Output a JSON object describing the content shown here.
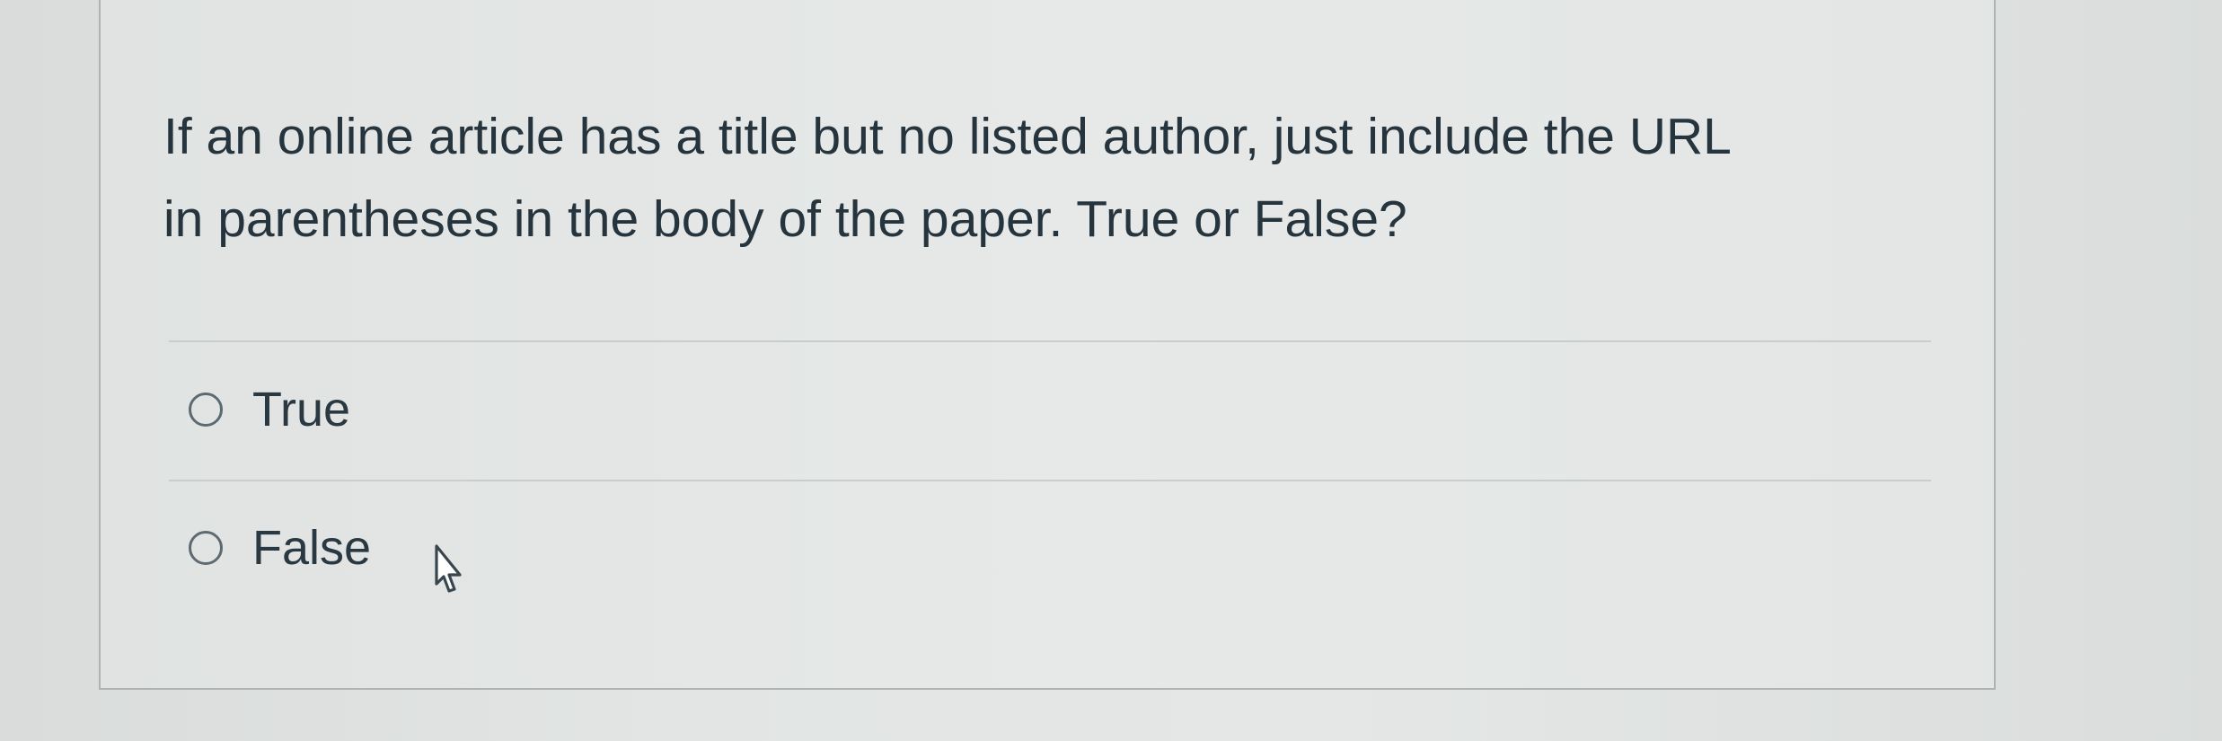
{
  "question": {
    "text": "If an online article has a title but no listed author, just include the URL\nin parentheses in the body of the paper. True or False?"
  },
  "answers": [
    {
      "label": "True",
      "selected": false
    },
    {
      "label": "False",
      "selected": false
    }
  ],
  "colors": {
    "background": "#e2e5e4",
    "card_border": "#aeb3b4",
    "text": "#26343e",
    "divider": "#c9cdcd",
    "radio_border": "#5d6a72"
  },
  "icons": {
    "radio": "radio-unchecked-icon",
    "pointer": "hand-pointer-cursor-icon"
  }
}
